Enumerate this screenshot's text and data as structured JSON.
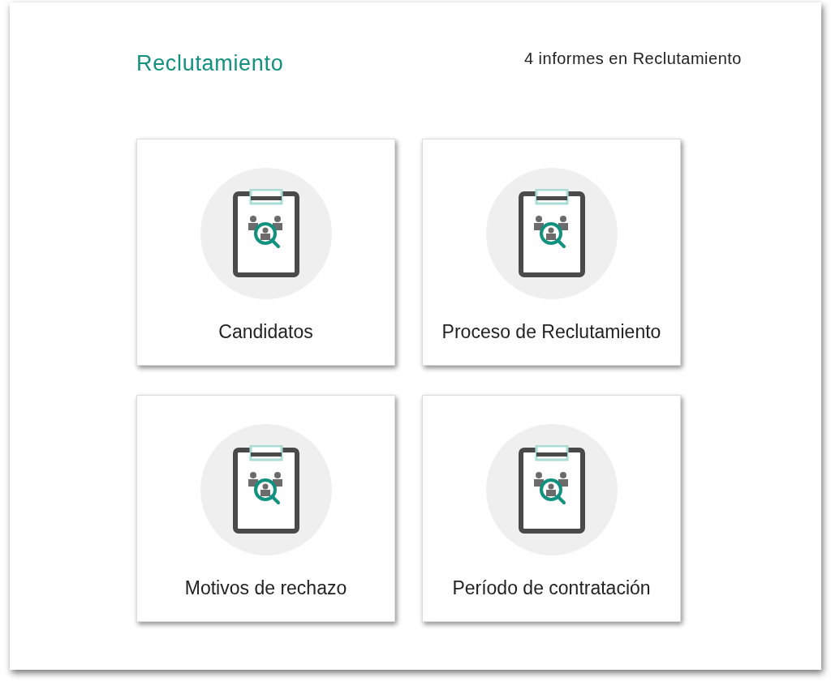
{
  "header": {
    "title": "Reclutamiento",
    "count": "4 informes en Reclutamiento"
  },
  "reports": [
    {
      "label": "Candidatos"
    },
    {
      "label": "Proceso de Reclutamiento"
    },
    {
      "label": "Motivos de rechazo"
    },
    {
      "label": "Período de contratación"
    }
  ]
}
